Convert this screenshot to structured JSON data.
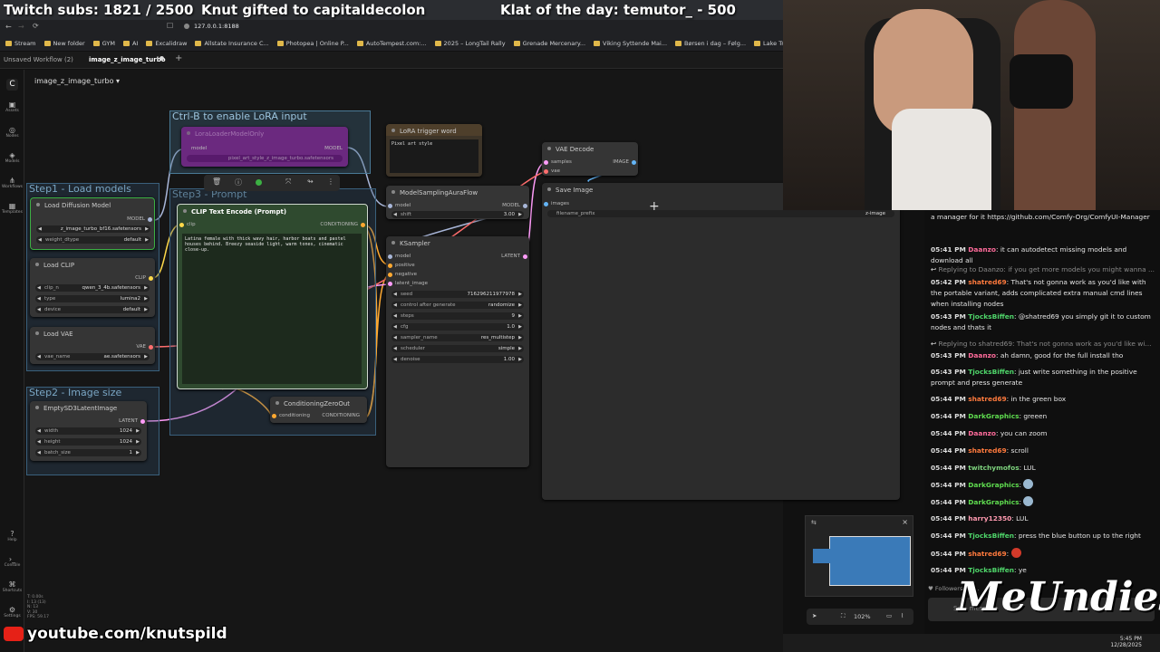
{
  "overlay": {
    "subs": "Twitch subs: 1821 / 2500",
    "gift": "Knut gifted to capitaldecolon",
    "klat": "Klat of the day: temutor_ - 500"
  },
  "browser": {
    "url": "127.0.0.1:8188",
    "bookmarks": [
      "Stream",
      "New folder",
      "GYM",
      "AI",
      "Excalidraw",
      "Allstate Insurance C...",
      "Photopea | Online P...",
      "AutoTempest.com:...",
      "2025 – LongTail Rally",
      "Grenade Mercenary...",
      "Viking Syttende Mai...",
      "Børsen i dag – Følg...",
      "Lake Travis Pontoon...",
      "Activ"
    ]
  },
  "app": {
    "tabs": [
      "Unsaved Workflow (2)",
      "image_z_image_turbo"
    ],
    "workflow_name": "image_z_image_turbo",
    "sidebar": [
      "Assets",
      "Nodes",
      "Models",
      "Workflows",
      "Templates",
      "Help",
      "Console",
      "Shortcuts",
      "Settings"
    ],
    "stats": [
      "T: 0.00s",
      "I: 13 (13)",
      "N: 13",
      "V: 30",
      "FPS: 59.17"
    ],
    "zoom": "102%"
  },
  "groups": {
    "lora": "Ctrl-B to enable LoRA input",
    "step1": "Step1 - Load models",
    "step2": "Step2 - Image size",
    "step3": "Step3 - Prompt"
  },
  "nodes": {
    "lora_loader": {
      "title": "LoraLoaderModelOnly",
      "in": "model",
      "out": "MODEL",
      "widget": "pixel_art_style_z_image_turbo.safetensors"
    },
    "lora_trigger": {
      "title": "LoRA trigger word",
      "text": "Pixel art style"
    },
    "vae_decode": {
      "title": "VAE Decode",
      "in1": "samples",
      "in2": "vae",
      "out": "IMAGE"
    },
    "save_image": {
      "title": "Save Image",
      "in": "images",
      "w_label": "filename_prefix",
      "w_value": "z-image"
    },
    "load_diffusion": {
      "title": "Load Diffusion Model",
      "out": "MODEL",
      "w1_value": "z_image_turbo_bf16.safetensors",
      "w2_label": "weight_dtype",
      "w2_value": "default"
    },
    "load_clip": {
      "title": "Load CLIP",
      "out": "CLIP",
      "w1_label": "clip_n",
      "w1_value": "qwen_3_4b.safetensors",
      "w2_label": "type",
      "w2_value": "lumina2",
      "w3_label": "device",
      "w3_value": "default"
    },
    "load_vae": {
      "title": "Load VAE",
      "out": "VAE",
      "w1_label": "vae_name",
      "w1_value": "ae.safetensors"
    },
    "empty_latent": {
      "title": "EmptySD3LatentImage",
      "out": "LATENT",
      "w1_label": "width",
      "w1_value": "1024",
      "w2_label": "height",
      "w2_value": "1024",
      "w3_label": "batch_size",
      "w3_value": "1"
    },
    "clip_text": {
      "title": "CLIP Text Encode (Prompt)",
      "in": "clip",
      "out": "CONDITIONING",
      "prompt": "Latina female with thick wavy hair, harbor boats and pastel houses behind. Breezy seaside light, warm tones, cinematic close-up."
    },
    "model_sampling": {
      "title": "ModelSamplingAuraFlow",
      "in": "model",
      "out": "MODEL",
      "w_label": "shift",
      "w_value": "3.00"
    },
    "ksampler": {
      "title": "KSampler",
      "in1": "model",
      "in2": "positive",
      "in3": "negative",
      "in4": "latent_image",
      "out": "LATENT",
      "widgets": [
        [
          "seed",
          "716296211977978"
        ],
        [
          "control after generate",
          "randomize"
        ],
        [
          "steps",
          "9"
        ],
        [
          "cfg",
          "1.0"
        ],
        [
          "sampler_name",
          "res_multistep"
        ],
        [
          "scheduler",
          "simple"
        ],
        [
          "denoise",
          "1.00"
        ]
      ]
    },
    "cond_zero": {
      "title": "ConditioningZeroOut",
      "in": "conditioning",
      "out": "CONDITIONING"
    }
  },
  "chat": [
    {
      "time": "",
      "user": "",
      "text": "a manager for it https://github.com/Comfy-Org/ComfyUI-Manager",
      "color": "#e6e6e6"
    },
    {
      "time": "05:41 PM",
      "user": "Daanzo",
      "text": "it can autodetect missing models and download all",
      "color": "#ff6b9b"
    },
    {
      "time": "",
      "user": "",
      "text": "Replying to Daanzo: if you get more models you might wanna ...",
      "reply": true,
      "color": "#8a8a8a"
    },
    {
      "time": "05:42 PM",
      "user": "shatred69",
      "text": "That's not gonna work as you'd like with the portable variant, adds complicated extra manual cmd lines when installing nodes",
      "color": "#ff7a3d"
    },
    {
      "time": "05:43 PM",
      "user": "TjocksBiffen",
      "text": "@shatred69 you simply git it to custom nodes and thats it",
      "color": "#4fd66a"
    },
    {
      "time": "",
      "user": "",
      "text": "Replying to shatred69: That's not gonna work as you'd like wi...",
      "reply": true,
      "color": "#8a8a8a"
    },
    {
      "time": "05:43 PM",
      "user": "Daanzo",
      "text": "ah damn, good for the full install tho",
      "color": "#ff6b9b"
    },
    {
      "time": "05:43 PM",
      "user": "TjocksBiffen",
      "text": "just write something in the positive prompt and press generate",
      "color": "#4fd66a"
    },
    {
      "time": "05:44 PM",
      "user": "shatred69",
      "text": "in the green box",
      "color": "#ff7a3d"
    },
    {
      "time": "05:44 PM",
      "user": "DarkGraphics",
      "text": "greeen",
      "color": "#5fdc4f"
    },
    {
      "time": "05:44 PM",
      "user": "Daanzo",
      "text": "you can zoom",
      "color": "#ff6b9b"
    },
    {
      "time": "05:44 PM",
      "user": "shatred69",
      "text": "scroll",
      "color": "#ff7a3d"
    },
    {
      "time": "05:44 PM",
      "user": "twitchymofos",
      "text": "LUL",
      "color": "#7ed37e"
    },
    {
      "time": "05:44 PM",
      "user": "DarkGraphics",
      "text": "",
      "emote": true,
      "color": "#5fdc4f"
    },
    {
      "time": "05:44 PM",
      "user": "DarkGraphics",
      "text": "",
      "emote": true,
      "color": "#5fdc4f"
    },
    {
      "time": "05:44 PM",
      "user": "harry12350",
      "text": "LUL",
      "color": "#ff9ab0"
    },
    {
      "time": "05:44 PM",
      "user": "TjocksBiffen",
      "text": "press the blue button up to the right",
      "color": "#4fd66a"
    },
    {
      "time": "05:44 PM",
      "user": "shatred69",
      "text": "",
      "emote": true,
      "color": "#ff7a3d"
    },
    {
      "time": "05:44 PM",
      "user": "TjocksBiffen",
      "text": "ye",
      "color": "#4fd66a"
    }
  ],
  "chat_footer": {
    "followers": "Followers onl...",
    "input": "Se... message"
  },
  "youtube": "youtube.com/knutspild",
  "sponsor": "MeUndies",
  "clock": {
    "time": "5:45 PM",
    "date": "12/28/2025"
  }
}
